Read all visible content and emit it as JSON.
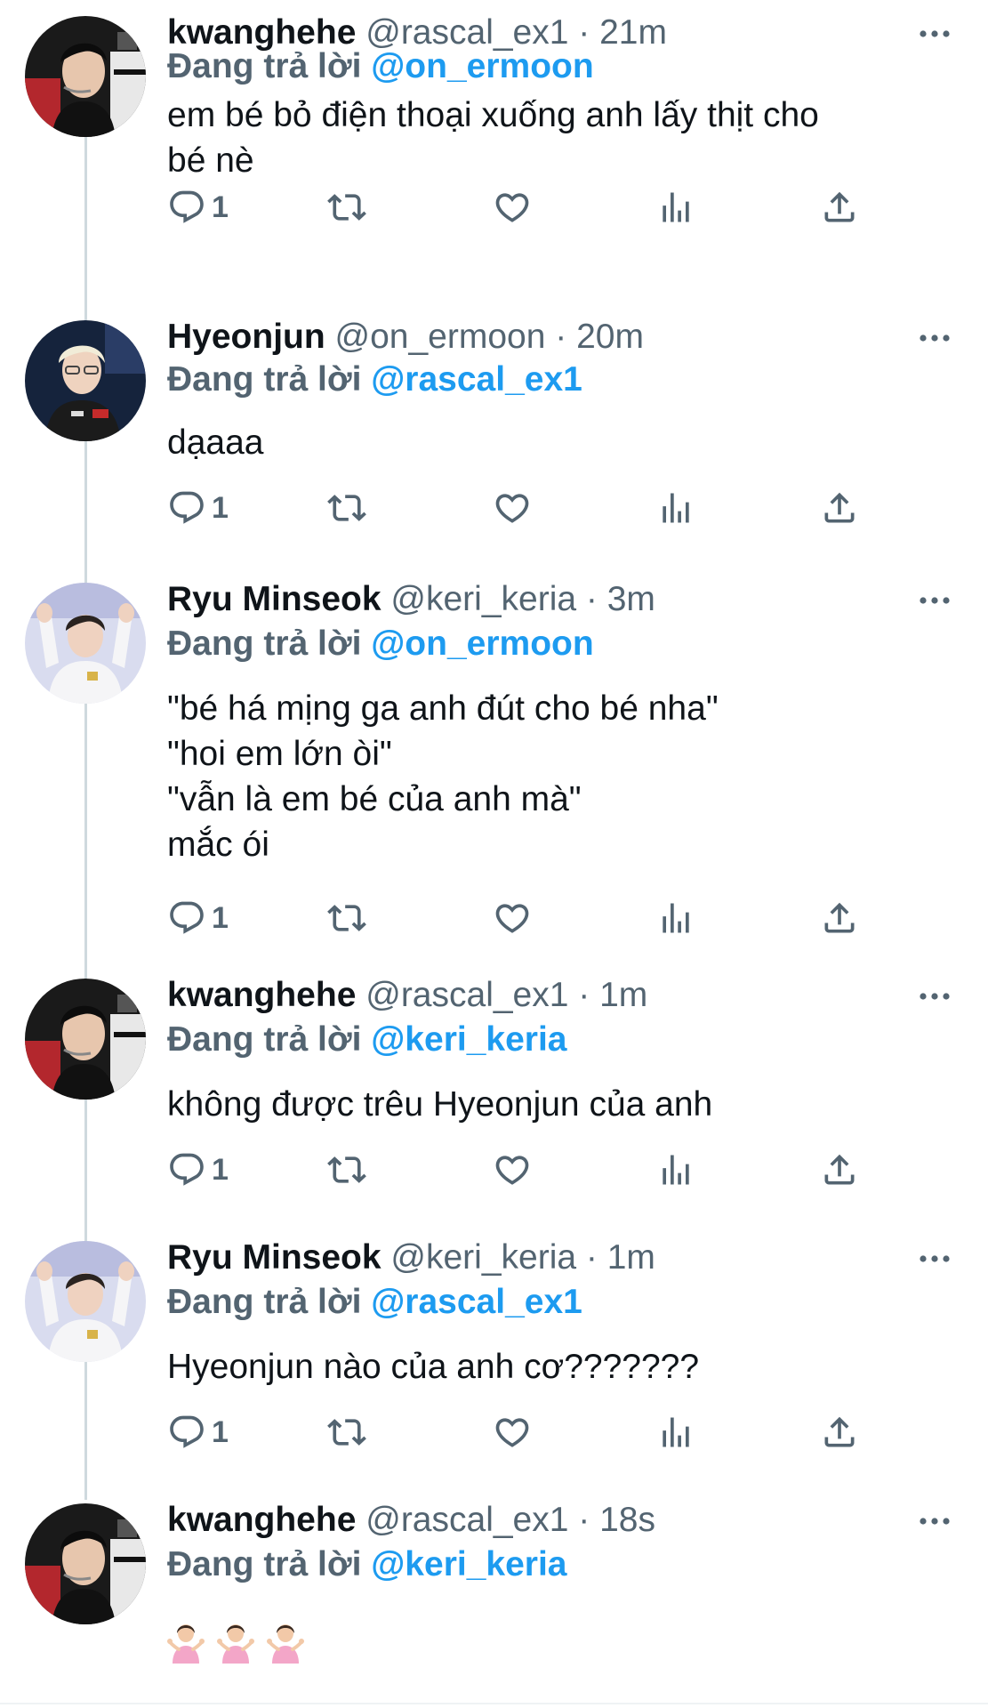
{
  "tweets": [
    {
      "name": "kwanghehe",
      "meta": "@rascal_ex1 · 21m",
      "reply_prefix": "Đang trả lời",
      "reply_handle": "@on_ermoon",
      "body": "em bé bỏ điện thoại xuống anh lấy thịt cho\nbé nè",
      "reply_count": "1"
    },
    {
      "name": "Hyeonjun",
      "meta": "@on_ermoon · 20m",
      "reply_prefix": "Đang trả lời",
      "reply_handle": "@rascal_ex1",
      "body": "dạaaa",
      "reply_count": "1"
    },
    {
      "name": "Ryu Minseok",
      "meta": "@keri_keria · 3m",
      "reply_prefix": "Đang trả lời",
      "reply_handle": "@on_ermoon",
      "body": "\"bé há mịng ga anh đút cho bé nha\"\n\"hoi em lớn òi\"\n\"vẫn là em bé của anh mà\"\nmắc ói",
      "reply_count": "1"
    },
    {
      "name": "kwanghehe",
      "meta": "@rascal_ex1 · 1m",
      "reply_prefix": "Đang trả lời",
      "reply_handle": "@keri_keria",
      "body": "không được trêu Hyeonjun của anh",
      "reply_count": "1"
    },
    {
      "name": "Ryu Minseok",
      "meta": "@keri_keria · 1m",
      "reply_prefix": "Đang trả lời",
      "reply_handle": "@rascal_ex1",
      "body": "Hyeonjun nào của anh cơ???????",
      "reply_count": "1"
    },
    {
      "name": "kwanghehe",
      "meta": "@rascal_ex1 · 18s",
      "reply_prefix": "Đang trả lời",
      "reply_handle": "@keri_keria",
      "body_emoji": [
        "person-shrugging",
        "person-shrugging",
        "person-shrugging"
      ]
    }
  ],
  "icons": {
    "reply": "reply-icon",
    "retweet": "retweet-icon",
    "like": "heart-icon",
    "views": "views-icon",
    "share": "share-icon",
    "more": "more-icon"
  },
  "colors": {
    "link": "#1d9bf0",
    "muted": "#536471",
    "text": "#0f1419",
    "thread_line": "#cfd9de"
  }
}
